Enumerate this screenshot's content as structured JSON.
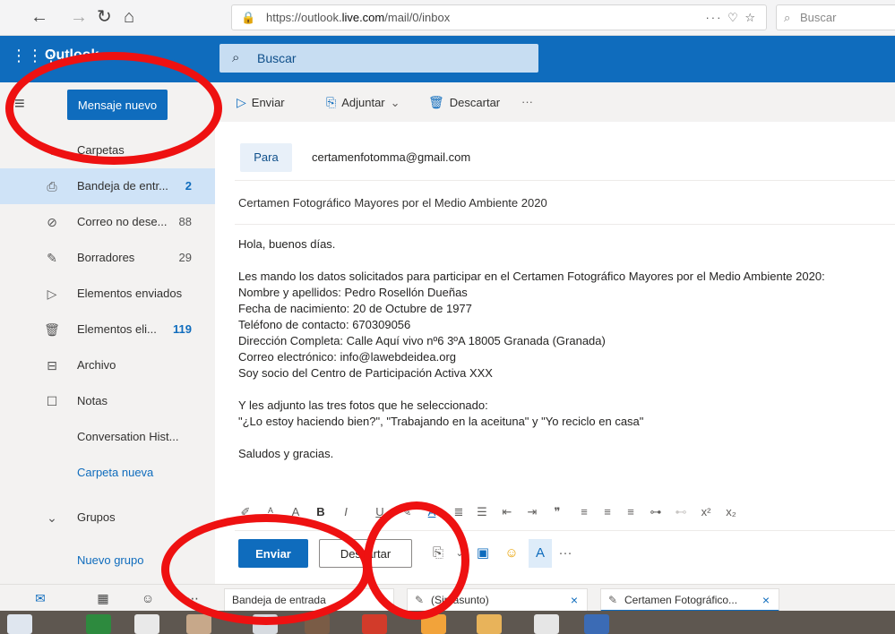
{
  "browser": {
    "url_prefix": "https://outlook.",
    "url_host": "live.com",
    "url_path": "/mail/0/inbox",
    "search_placeholder": "Buscar"
  },
  "header": {
    "brand": "Outlook",
    "search_placeholder": "Buscar"
  },
  "sidebar": {
    "new_message": "Mensaje nuevo",
    "folders_title": "Carpetas",
    "folders": [
      {
        "label": "Bandeja de entr...",
        "count": "2"
      },
      {
        "label": "Correo no dese...",
        "count": "88"
      },
      {
        "label": "Borradores",
        "count": "29"
      },
      {
        "label": "Elementos enviados",
        "count": ""
      },
      {
        "label": "Elementos eli...",
        "count": "119"
      },
      {
        "label": "Archivo",
        "count": ""
      },
      {
        "label": "Notas",
        "count": ""
      },
      {
        "label": "Conversation Hist...",
        "count": ""
      }
    ],
    "new_folder": "Carpeta nueva",
    "groups_title": "Grupos",
    "new_group": "Nuevo grupo"
  },
  "commandbar": {
    "send": "Enviar",
    "attach": "Adjuntar",
    "discard": "Descartar"
  },
  "compose": {
    "to_label": "Para",
    "to_value": "certamenfotomma@gmail.com",
    "subject": "Certamen Fotográfico Mayores por el Medio Ambiente 2020",
    "body": [
      "Hola, buenos días.",
      "",
      "Les mando los datos solicitados para participar en el Certamen Fotográfico Mayores por el Medio Ambiente 2020:",
      "Nombre y apellidos: Pedro Rosellón Dueñas",
      "Fecha de nacimiento: 20 de Octubre de 1977",
      "Teléfono de contacto: 670309056",
      "Dirección Completa: Calle Aquí vivo nº6 3ºA 18005 Granada (Granada)",
      "Correo electrónico: info@lawebdeidea.org",
      "Soy socio del Centro de Participación Activa XXX",
      "",
      "Y les adjunto las tres fotos que he seleccionado:",
      "\"¿Lo estoy haciendo bien?\", \"Trabajando en la aceituna\" y \"Yo reciclo en casa\"",
      "",
      "Saludos y gracias."
    ],
    "send_button": "Enviar",
    "discard_button": "Descartar"
  },
  "tabs": [
    {
      "label": "Bandeja de entrada"
    },
    {
      "label": "(Sin asunto)"
    },
    {
      "label": "Certamen Fotográfico..."
    }
  ],
  "colors": {
    "brand_blue": "#0f6cbd",
    "annotation_red": "#ee1111"
  }
}
